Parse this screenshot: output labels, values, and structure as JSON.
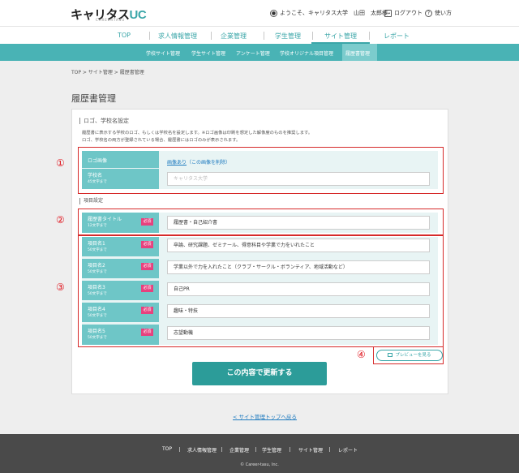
{
  "header": {
    "logo_main": "キャリタス",
    "logo_accent": "UC",
    "logo_sub": "CAREERTASU",
    "welcome": "ようこそ、キャリタス大学　山田　太郎様",
    "logout": "ログアウト",
    "help": "使い方"
  },
  "gnav": {
    "items": [
      "TOP",
      "求人情報管理",
      "企業管理",
      "学生管理",
      "サイト管理",
      "レポート"
    ],
    "active": "サイト管理"
  },
  "snav": {
    "items": [
      "学校サイト管理",
      "学生サイト管理",
      "アンケート管理",
      "学校オリジナル項目管理",
      "履歴書管理"
    ],
    "active": "履歴書管理"
  },
  "breadcrumb": "TOP > サイト管理 > 履歴書管理",
  "page_title": "履歴書管理",
  "logo_section": {
    "heading": "ロゴ、学校名設定",
    "desc1": "履歴書に表示する学校のロゴ、もしくは学校名を設定します。※ロゴ画像は印刷を想定した解像度のものを推奨します。",
    "desc2": "ロゴ、学校名の両方が登録されている場合、履歴書にはロゴのみが表示されます。",
    "logo_label": "ロゴ画像",
    "logo_link": "画像あり",
    "logo_delete": "（この画像を削除）",
    "school_label": "学校名",
    "school_limit": "45文字まで",
    "school_placeholder": "キャリタス大学"
  },
  "item_section": {
    "heading": "項目設定",
    "required_badge": "必須",
    "title_label": "履歴書タイトル",
    "title_limit": "12文字まで",
    "title_value": "履歴書・自己紹介書",
    "items": [
      {
        "label": "項目名1",
        "limit": "50文字まで",
        "value": "卒論、研究課題、ゼミナール、得意科目や学業で力をいれたこと"
      },
      {
        "label": "項目名2",
        "limit": "50文字まで",
        "value": "学業以外で力を入れたこと（クラブ・サークル・ボランティア、地域活動など）"
      },
      {
        "label": "項目名3",
        "limit": "50文字まで",
        "value": "自己PR"
      },
      {
        "label": "項目名4",
        "limit": "50文字まで",
        "value": "趣味・特技"
      },
      {
        "label": "項目名5",
        "limit": "50文字まで",
        "value": "志望動機"
      }
    ]
  },
  "annotations": [
    "①",
    "②",
    "③",
    "④"
  ],
  "preview_button": "プレビューを見る",
  "submit_button": "この内容で更新する",
  "back_link": "< サイト管理トップへ戻る",
  "footer": {
    "items": [
      "TOP",
      "求人情報管理",
      "企業管理",
      "学生管理",
      "サイト管理",
      "レポート"
    ],
    "copyright": "© Career-tasu, Inc."
  },
  "colors": {
    "accent": "#3aa6a8",
    "subnav": "#49b3b5",
    "label_bg": "#6ec6c7",
    "required": "#e6417e",
    "annotation": "#e0141d",
    "submit": "#2c9c99"
  }
}
